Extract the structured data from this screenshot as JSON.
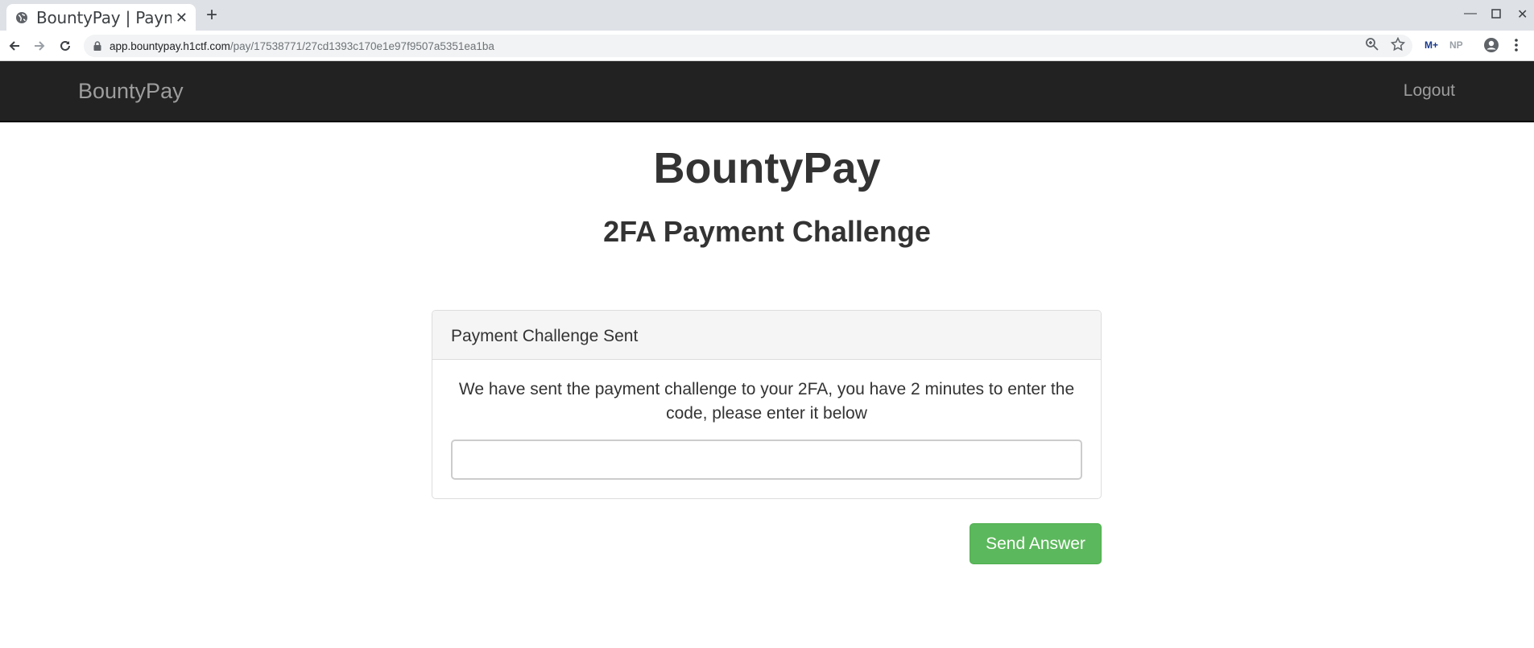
{
  "browser": {
    "tab_title": "BountyPay | Payment",
    "url_host": "app.bountypay.h1ctf.com",
    "url_path": "/pay/17538771/27cd1393c170e1e97f9507a5351ea1ba",
    "extensions": [
      "M+",
      "NP"
    ],
    "icons": [
      "globe-icon",
      "close-icon",
      "plus-icon",
      "minimize-icon",
      "maximize-icon",
      "window-close-icon",
      "back-arrow-icon",
      "forward-arrow-icon",
      "reload-icon",
      "lock-icon",
      "zoom-icon",
      "star-icon",
      "profile-icon",
      "kebab-menu-icon"
    ]
  },
  "navbar": {
    "brand": "BountyPay",
    "logout": "Logout"
  },
  "header": {
    "title": "BountyPay",
    "subtitle": "2FA Payment Challenge"
  },
  "panel": {
    "heading": "Payment Challenge Sent",
    "message": "We have sent the payment challenge to your 2FA, you have 2 minutes to enter the code, please enter it below",
    "input_value": "",
    "input_placeholder": ""
  },
  "actions": {
    "send_label": "Send Answer"
  },
  "colors": {
    "navbar_bg": "#222222",
    "navbar_text": "#9d9d9d",
    "button_green": "#5cb85c",
    "panel_heading_bg": "#f5f5f5"
  }
}
